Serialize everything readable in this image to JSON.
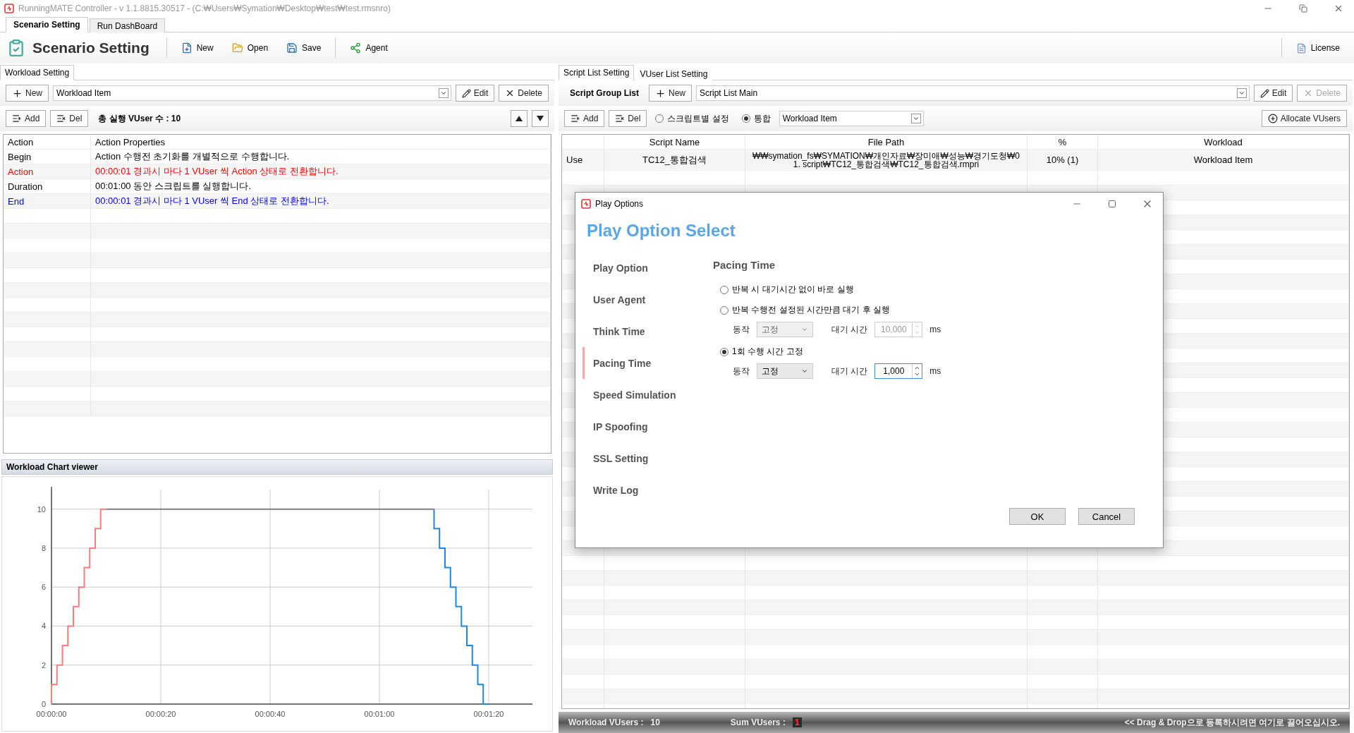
{
  "window": {
    "title": "RunningMATE Controller - v 1.1.8815.30517 - (C:₩Users₩Symation₩Desktop₩test₩test.rmsnro)"
  },
  "main_tabs": [
    {
      "label": "Scenario Setting",
      "selected": true
    },
    {
      "label": "Run DashBoard",
      "selected": false
    }
  ],
  "toolbar": {
    "title": "Scenario Setting",
    "buttons": [
      {
        "label": "New",
        "kind": "new"
      },
      {
        "label": "Open",
        "kind": "open"
      },
      {
        "label": "Save",
        "kind": "save"
      },
      {
        "label": "Agent",
        "kind": "agent"
      }
    ],
    "license": "License"
  },
  "workload_panel": {
    "tab": "Workload Setting",
    "new_button": "New",
    "workload_select": "Workload Item",
    "edit_button": "Edit",
    "delete_button": "Delete",
    "add_button": "Add",
    "del_button": "Del",
    "total_vusers": "총 실행 VUser 수 : 10",
    "columns": [
      "Action",
      "Action Properties"
    ],
    "rows": [
      {
        "name": "Begin",
        "properties": "Action 수행전 초기화를 개별적으로 수행합니다.",
        "color": "#000000"
      },
      {
        "name": "Action",
        "properties": "00:00:01 경과시 마다 1 VUser 씩 Action 상태로 전환합니다.",
        "color": "#ff0000"
      },
      {
        "name": "Duration",
        "properties": "00:01:00 동안 스크립트를 실행합니다.",
        "color": "#000000"
      },
      {
        "name": "End",
        "properties": "00:00:01 경과시 마다 1 VUser 씩 End 상태로 전환합니다.",
        "color": "#0000ff"
      }
    ]
  },
  "chart_panel": {
    "title": "Workload Chart viewer",
    "chart_data": {
      "type": "line",
      "grid": true,
      "x": [
        0,
        0,
        1,
        1,
        2,
        2,
        3,
        3,
        4,
        4,
        5,
        5,
        6,
        6,
        7,
        7,
        8,
        8,
        9,
        9,
        10,
        70,
        70,
        71,
        71,
        72,
        72,
        73,
        73,
        74,
        74,
        75,
        75,
        76,
        76,
        77,
        77,
        78,
        78,
        79,
        79,
        80
      ],
      "series": [
        {
          "color": "#ff7b7b",
          "values": [
            0,
            1,
            1,
            2,
            2,
            3,
            3,
            4,
            4,
            5,
            5,
            6,
            6,
            7,
            7,
            8,
            8,
            9,
            9,
            10,
            10,
            null,
            null,
            null,
            null,
            null,
            null,
            null,
            null,
            null,
            null,
            null,
            null,
            null,
            null,
            null,
            null,
            null,
            null,
            null,
            null,
            null
          ]
        },
        {
          "color": "#808080",
          "values": [
            null,
            null,
            null,
            null,
            null,
            null,
            null,
            null,
            null,
            null,
            null,
            null,
            null,
            null,
            null,
            null,
            null,
            null,
            null,
            null,
            10,
            10,
            null,
            null,
            null,
            null,
            null,
            null,
            null,
            null,
            null,
            null,
            null,
            null,
            null,
            null,
            null,
            null,
            null,
            null,
            null,
            null
          ]
        },
        {
          "color": "#1e88e5",
          "values": [
            null,
            null,
            null,
            null,
            null,
            null,
            null,
            null,
            null,
            null,
            null,
            null,
            null,
            null,
            null,
            null,
            null,
            null,
            null,
            null,
            null,
            10,
            9,
            9,
            8,
            8,
            7,
            7,
            6,
            6,
            5,
            5,
            4,
            4,
            3,
            3,
            2,
            2,
            1,
            1,
            0,
            0
          ]
        }
      ],
      "xlim": [
        0,
        88
      ],
      "ylim": [
        0,
        11
      ],
      "xticks": [
        {
          "value": 0,
          "label": "00:00:00"
        },
        {
          "value": 20,
          "label": "00:00:20"
        },
        {
          "value": 40,
          "label": "00:00:40"
        },
        {
          "value": 60,
          "label": "00:01:00"
        },
        {
          "value": 80,
          "label": "00:01:20"
        }
      ],
      "yticks": [
        0,
        2,
        4,
        6,
        8,
        10
      ]
    }
  },
  "script_panel": {
    "tabs": [
      {
        "label": "Script List Setting",
        "selected": true
      },
      {
        "label": "VUser List Setting",
        "selected": false
      }
    ],
    "group_label": "Script Group List",
    "new_button": "New",
    "group_select": "Script List Main",
    "edit_button": "Edit",
    "delete_button": {
      "label": "Delete",
      "disabled": true
    },
    "add_button": "Add",
    "del_button": "Del",
    "modes": [
      {
        "label": "스크립트별 설정",
        "selected": false
      },
      {
        "label": "통합",
        "selected": true
      }
    ],
    "workload_select": "Workload Item",
    "allocate_button": "Allocate VUsers",
    "columns": [
      "Script Name",
      "File Path",
      "%",
      "Workload"
    ],
    "rows": [
      {
        "use": "Use",
        "script_name": "TC12_통합검색",
        "file_path": "₩₩symation_fs₩SYMATION₩개인자료₩장미애₩성능₩경기도청₩01. script₩TC12_통합검색₩TC12_통합검색.rmpri",
        "percent": "10% (1)",
        "workload": "Workload Item"
      }
    ]
  },
  "status_bar": {
    "workload_label": "Workload VUsers :",
    "workload_value": "10",
    "sum_label": "Sum VUsers :",
    "sum_value": "1",
    "hint": "<< Drag & Drop으로 등록하시려면 여기로 끌어오십시오."
  },
  "dialog": {
    "title": "Play Options",
    "heading": "Play Option Select",
    "nav": [
      {
        "label": "Play Option",
        "selected": false
      },
      {
        "label": "User Agent",
        "selected": false
      },
      {
        "label": "Think Time",
        "selected": false
      },
      {
        "label": "Pacing Time",
        "selected": true
      },
      {
        "label": "Speed Simulation",
        "selected": false
      },
      {
        "label": "IP Spoofing",
        "selected": false
      },
      {
        "label": "SSL Setting",
        "selected": false
      },
      {
        "label": "Write Log",
        "selected": false
      }
    ],
    "section_title": "Pacing Time",
    "options": [
      {
        "label": "반복 시 대기시간 없이 바로 실행",
        "selected": false
      },
      {
        "label": "반복 수행전 설정된 시간만큼 대기 후 실행",
        "selected": false,
        "settings": {
          "action_label": "동작",
          "action_value": "고정",
          "wait_label": "대기 시간",
          "wait_value": "10,000",
          "unit": "ms",
          "disabled": true
        }
      },
      {
        "label": "1회 수행 시간 고정",
        "selected": true,
        "settings": {
          "action_label": "동작",
          "action_value": "고정",
          "wait_label": "대기 시간",
          "wait_value": "1,000",
          "unit": "ms",
          "disabled": false
        }
      }
    ],
    "buttons": [
      "OK",
      "Cancel"
    ]
  }
}
